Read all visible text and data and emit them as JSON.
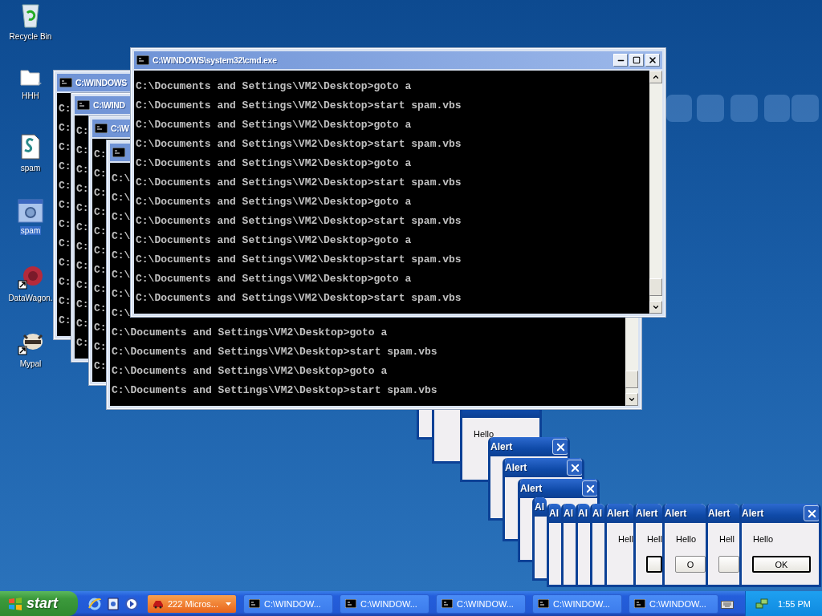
{
  "desktop_icons": [
    {
      "label": "Recycle Bin",
      "kind": "bin",
      "selected": false
    },
    {
      "label": "HHH",
      "kind": "folder",
      "selected": false
    },
    {
      "label": "spam",
      "kind": "script",
      "selected": false
    },
    {
      "label": "spam",
      "kind": "program",
      "selected": true
    },
    {
      "label": "DataWagon.",
      "kind": "tree",
      "selected": false
    },
    {
      "label": "Mypal",
      "kind": "animal",
      "selected": false
    }
  ],
  "cmd_windows": [
    {
      "title": "C:\\WINDOWS",
      "lines": [
        "C:",
        "C:",
        "C:",
        "C:",
        "C:",
        "C:",
        "C:",
        "C:",
        "C:",
        "C:",
        "C:",
        "C:"
      ]
    },
    {
      "title": "C:\\WIND",
      "lines": [
        "C:",
        "C:",
        "C:",
        "C:",
        "C:",
        "C:",
        "C:",
        "C:",
        "C:",
        "C:",
        "C:",
        "C:"
      ]
    },
    {
      "title": "C:\\W",
      "lines": [
        "C:",
        "C:",
        "C:",
        "C:",
        "C:",
        "C:",
        "C:",
        "C:",
        "C:",
        "C:",
        "C:",
        "C:"
      ]
    },
    {
      "lines": [
        "C:\\",
        "C:\\",
        "C:\\",
        "C:\\",
        "C:\\",
        "C:\\",
        "C:\\",
        "C:\\",
        "C:\\Documents and Settings\\VM2\\Desktop>goto a",
        "C:\\Documents and Settings\\VM2\\Desktop>start spam.vbs",
        "C:\\Documents and Settings\\VM2\\Desktop>goto a",
        "C:\\Documents and Settings\\VM2\\Desktop>start spam.vbs"
      ]
    },
    {
      "title": "C:\\WINDOWS\\system32\\cmd.exe",
      "lines": [
        "C:\\Documents and Settings\\VM2\\Desktop>goto a",
        "C:\\Documents and Settings\\VM2\\Desktop>start spam.vbs",
        "C:\\Documents and Settings\\VM2\\Desktop>goto a",
        "C:\\Documents and Settings\\VM2\\Desktop>start spam.vbs",
        "C:\\Documents and Settings\\VM2\\Desktop>goto a",
        "C:\\Documents and Settings\\VM2\\Desktop>start spam.vbs",
        "C:\\Documents and Settings\\VM2\\Desktop>goto a",
        "C:\\Documents and Settings\\VM2\\Desktop>start spam.vbs",
        "C:\\Documents and Settings\\VM2\\Desktop>goto a",
        "C:\\Documents and Settings\\VM2\\Desktop>start spam.vbs",
        "C:\\Documents and Settings\\VM2\\Desktop>goto a",
        "C:\\Documents and Settings\\VM2\\Desktop>start spam.vbs"
      ]
    }
  ],
  "alerts": [
    {
      "kind": "alert"
    },
    {
      "kind": "alert"
    },
    {
      "kind": "alert",
      "message": "Hello"
    },
    {
      "kind": "alert",
      "title": "Alert",
      "close": true
    },
    {
      "kind": "alert",
      "title": "Alert",
      "close": true
    },
    {
      "kind": "alert",
      "title": "Alert",
      "close": true
    },
    {
      "kind": "alert",
      "title": "Al"
    },
    {
      "kind": "alert",
      "title": "Al"
    },
    {
      "kind": "alert",
      "title": "Al"
    },
    {
      "kind": "alert",
      "title": "Al"
    },
    {
      "kind": "alert",
      "title": "Al"
    },
    {
      "kind": "alert",
      "title": "Alert",
      "message": "Hell"
    },
    {
      "kind": "alert",
      "title": "Alert",
      "message": "Hell",
      "button": {
        "default": true
      }
    },
    {
      "kind": "alert",
      "title": "Alert",
      "message": "Hello",
      "button": {
        "label": "O",
        "default": false
      }
    },
    {
      "kind": "alert",
      "title": "Alert",
      "message": "Hell",
      "button": {
        "default": false
      }
    },
    {
      "kind": "alert",
      "title": "Alert",
      "message": "Hello",
      "close": true,
      "button": {
        "label": "OK",
        "default": true
      }
    }
  ],
  "taskbar": {
    "start": "start",
    "tasks": [
      {
        "label": "222 Micros...",
        "kind": "group",
        "flashing": true,
        "selected": false
      },
      {
        "label": "C:\\WINDOW...",
        "kind": "window",
        "flashing": false,
        "selected": false
      },
      {
        "label": "C:\\WINDOW...",
        "kind": "window",
        "flashing": false,
        "selected": false
      },
      {
        "label": "C:\\WINDOW...",
        "kind": "window",
        "flashing": false,
        "selected": false
      },
      {
        "label": "C:\\WINDOW...",
        "kind": "window",
        "flashing": false,
        "selected": false
      },
      {
        "label": "C:\\WINDOW...",
        "kind": "window",
        "flashing": false,
        "selected": false
      }
    ],
    "clock": "1:55 PM"
  }
}
